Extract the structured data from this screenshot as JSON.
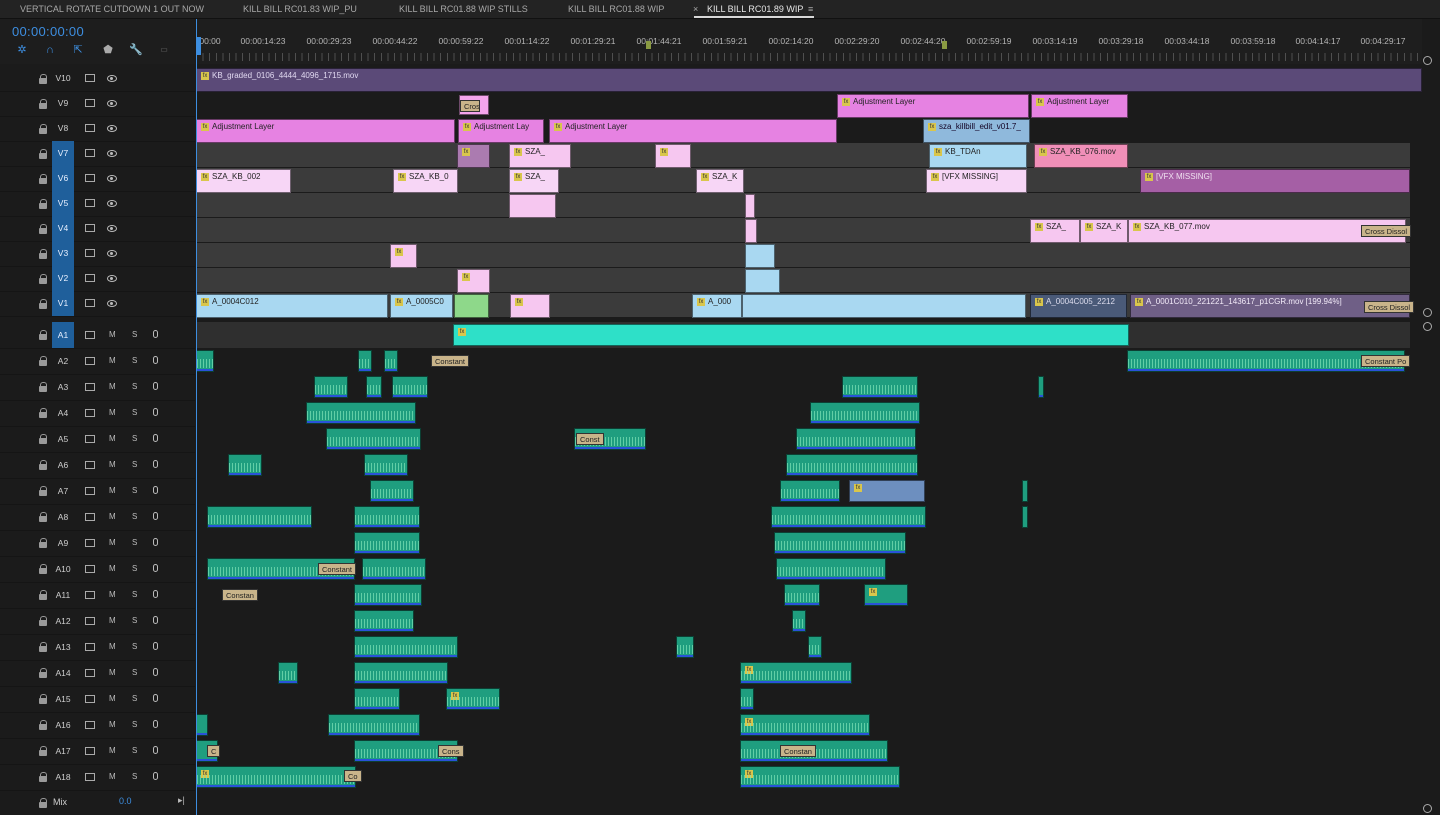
{
  "tabs": [
    {
      "label": "VERTICAL ROTATE CUTDOWN 1 OUT NOW"
    },
    {
      "label": "KILL BILL RC01.83 WIP_PU"
    },
    {
      "label": "KILL BILL RC01.88 WIP STILLS"
    },
    {
      "label": "KILL BILL RC01.88 WIP"
    },
    {
      "label": "KILL BILL RC01.89 WIP",
      "close": "×",
      "menu": "≡"
    }
  ],
  "timecode": "00:00:00:00",
  "ruler": [
    "00:00",
    "00:00:14:23",
    "00:00:29:23",
    "00:00:44:22",
    "00:00:59:22",
    "00:01:14:22",
    "00:01:29:21",
    "00:01:44:21",
    "00:01:59:21",
    "00:02:14:20",
    "00:02:29:20",
    "00:02:44:20",
    "00:02:59:19",
    "00:03:14:19",
    "00:03:29:18",
    "00:03:44:18",
    "00:03:59:18",
    "00:04:14:17",
    "00:04:29:17"
  ],
  "video_tracks": [
    "V10",
    "V9",
    "V8",
    "V7",
    "V6",
    "V5",
    "V4",
    "V3",
    "V2",
    "V1"
  ],
  "audio_tracks": [
    "A1",
    "A2",
    "A3",
    "A4",
    "A5",
    "A6",
    "A7",
    "A8",
    "A9",
    "A10",
    "A11",
    "A12",
    "A13",
    "A14",
    "A15",
    "A16",
    "A17",
    "A18"
  ],
  "audio_buttons": {
    "mute": "M",
    "solo": "S"
  },
  "mix": {
    "label": "Mix",
    "value": "0.0"
  },
  "clips": {
    "v10_grade": "KB_graded_0106_4444_4096_1715.mov",
    "adj": "Adjustment Layer",
    "adj_short": "Adjustment Lay",
    "cross": "Cross",
    "sza_edit": "sza_killbill_edit_v01.7_",
    "kb_tda": "KB_TDAn",
    "sza_076": "SZA_KB_076.mov",
    "sza_002": "SZA_KB_002",
    "sza_0": "SZA_KB_0",
    "sza": "SZA_",
    "sza_k": "SZA_K",
    "vfx": "[VFX MISSING]",
    "sza_s": "SZA_",
    "sza_077": "SZA_KB_077.mov",
    "cross_diss": "Cross Dissol",
    "a_0004": "A_0004C012",
    "a_0005": "A_0005C0",
    "a_000": "A_000",
    "a_0004c005": "A_0004C005_2212",
    "a_0001": "A_0001C010_221221_143617_p1CGR.mov [199.94%]",
    "constant": "Constant",
    "const_power": "Constant Po",
    "consta": "Constan",
    "const": "Const",
    "cons": "Cons",
    "co": "Co",
    "c": "C"
  },
  "colors": {
    "accent": "#3d8ee0",
    "adjustment": "#e682e2",
    "video": "#a9d8f1",
    "audio": "#1f9e7f",
    "selected_track": "#1f5f9b"
  }
}
